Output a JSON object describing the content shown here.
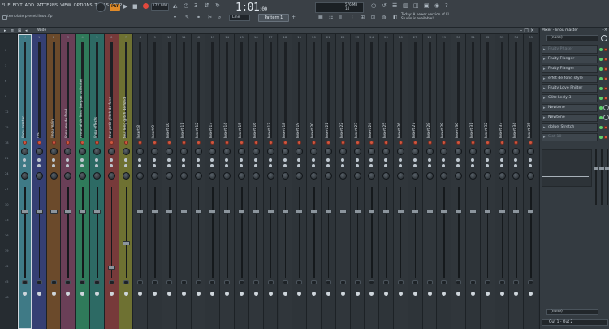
{
  "menu": [
    "FILE",
    "EDIT",
    "ADD",
    "PATTERNS",
    "VIEW",
    "OPTIONS",
    "TOOLS",
    "HELP"
  ],
  "toolbar": {
    "project_file": "template preset linou.flp",
    "mode": "PAT",
    "tempo": "172.000",
    "time": "1:01",
    "time_ticks": ":00",
    "cpu_line1": "576 MB",
    "cpu_line2": "14",
    "line_select": "Line",
    "pattern": "Pattern 1",
    "news": "Today: A newer version of FL Studio is available!"
  },
  "mixer": {
    "header_label": "Wide",
    "strips": [
      {
        "num": "M",
        "name": "linou master",
        "color": "#3f7a86",
        "fader": 0.26,
        "selected": true
      },
      {
        "num": "1",
        "name": "rec",
        "color": "#353f73",
        "fader": 0.26
      },
      {
        "num": "2",
        "name": "linou main",
        "color": "#6b4a2b",
        "fader": 0.26
      },
      {
        "num": "3",
        "name": "linou rev de fond",
        "color": "#6a3f57",
        "fader": 0.26
      },
      {
        "num": "4",
        "name": "rev oval de fond (ne pas activate)",
        "color": "#2f7a5a",
        "fader": 0.26
      },
      {
        "num": "5",
        "name": "linou effects",
        "color": "#2d6a64",
        "fader": 0.26
      },
      {
        "num": "6",
        "name": "tout petit glitch de fond",
        "color": "#773a3a",
        "fader": 0.9
      },
      {
        "num": "7",
        "name": "tout long glitch de fond",
        "color": "#6e7132",
        "fader": 0.62
      },
      {
        "num": "8",
        "name": "Insert 8"
      },
      {
        "num": "9",
        "name": "Insert 9"
      },
      {
        "num": "10",
        "name": "Insert 10"
      },
      {
        "num": "11",
        "name": "Insert 11"
      },
      {
        "num": "12",
        "name": "Insert 12"
      },
      {
        "num": "13",
        "name": "Insert 13"
      },
      {
        "num": "14",
        "name": "Insert 14"
      },
      {
        "num": "15",
        "name": "Insert 15"
      },
      {
        "num": "16",
        "name": "Insert 16"
      },
      {
        "num": "17",
        "name": "Insert 17"
      },
      {
        "num": "18",
        "name": "Insert 18"
      },
      {
        "num": "19",
        "name": "Insert 19"
      },
      {
        "num": "20",
        "name": "Insert 20"
      },
      {
        "num": "21",
        "name": "Insert 21"
      },
      {
        "num": "22",
        "name": "Insert 22"
      },
      {
        "num": "23",
        "name": "Insert 23"
      },
      {
        "num": "24",
        "name": "Insert 24"
      },
      {
        "num": "25",
        "name": "Insert 25"
      },
      {
        "num": "26",
        "name": "Insert 26"
      },
      {
        "num": "27",
        "name": "Insert 27"
      },
      {
        "num": "28",
        "name": "Insert 28"
      },
      {
        "num": "29",
        "name": "Insert 29"
      },
      {
        "num": "30",
        "name": "Insert 30"
      },
      {
        "num": "31",
        "name": "Insert 31"
      },
      {
        "num": "32",
        "name": "Insert 32"
      },
      {
        "num": "33",
        "name": "Insert 33"
      },
      {
        "num": "34",
        "name": "Insert 34"
      },
      {
        "num": "35",
        "name": "Insert 35"
      }
    ],
    "ruler_labels": [
      "0",
      "3",
      "6",
      "9",
      "12",
      "15",
      "18",
      "21",
      "24",
      "27",
      "30",
      "33",
      "36",
      "39",
      "42",
      "45",
      "48"
    ]
  },
  "panel": {
    "title": "Mixer - linou master",
    "preset_top": "(none)",
    "slots": [
      {
        "name": "Fruity Phaser",
        "dim": true
      },
      {
        "name": "Fruity Flanger"
      },
      {
        "name": "Fruity Flanger"
      },
      {
        "name": "effet de fond style"
      },
      {
        "name": "Fruity Love Philter"
      },
      {
        "name": "Glitz Lesly 3"
      },
      {
        "name": "Newtone"
      },
      {
        "name": "Newtone"
      },
      {
        "name": "dblue_Stretch"
      },
      {
        "name": "Slot 10",
        "dim": true
      }
    ],
    "preset_bottom": "(none)",
    "output": "Out 1 - Out 2"
  }
}
